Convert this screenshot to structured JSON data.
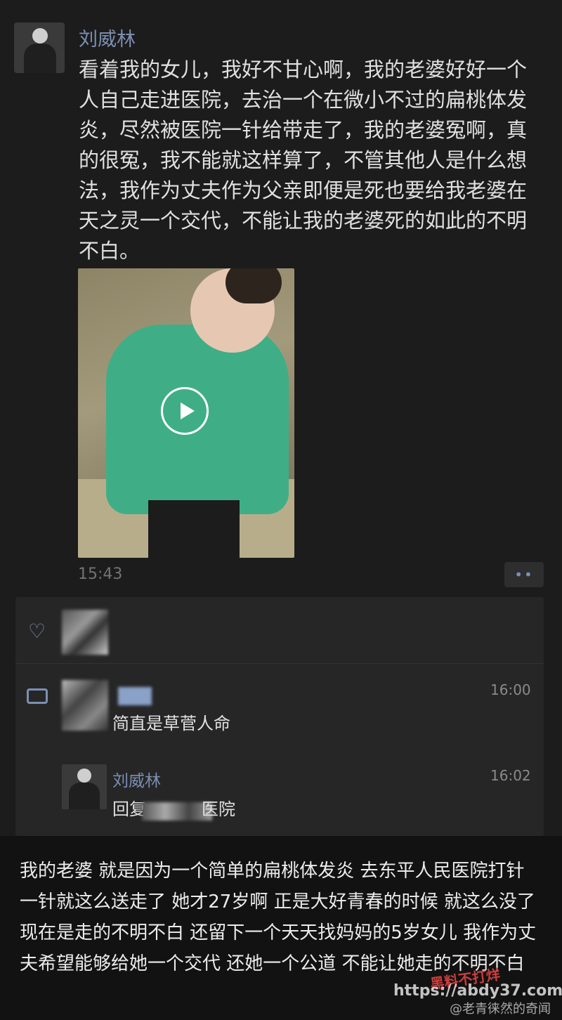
{
  "post": {
    "username": "刘威林",
    "text": "看着我的女儿，我好不甘心啊，我的老婆好好一个人自己走进医院，去治一个在微小不过的扁桃体发炎，尽然被医院一针给带走了，我的老婆冤啊，真的很冤，我不能就这样算了，不管其他人是什么想法，我作为丈夫作为父亲即便是死也要给我老婆在天之灵一个交代，不能让我的老婆死的如此的不明不白。",
    "time": "15:43",
    "more_label": "••"
  },
  "comments": [
    {
      "time": "16:00",
      "text": "简直是草菅人命"
    },
    {
      "name": "刘威林",
      "time": "16:02",
      "text_visible_start": "回复",
      "text_visible_end": "医院"
    }
  ],
  "caption": "我的老婆 就是因为一个简单的扁桃体发炎 去东平人民医院打针 一针就这么送走了 她才27岁啊 正是大好青春的时候 就这么没了 现在是走的不明不白 还留下一个天天找妈妈的5岁女儿 我作为丈夫希望能够给她一个交代 还她一个公道 不能让她走的不明不白",
  "watermark": {
    "site_name": "黑料不打烊",
    "url": "https://abdy37.com",
    "weibo": "@老青徕然的奇闻"
  },
  "colors": {
    "name_link": "#7c8fb3",
    "background": "#121212",
    "card": "#1c1c1c",
    "feedback_panel": "#262626"
  },
  "icons": [
    "heart-icon",
    "comment-icon",
    "play-icon",
    "more-icon"
  ]
}
